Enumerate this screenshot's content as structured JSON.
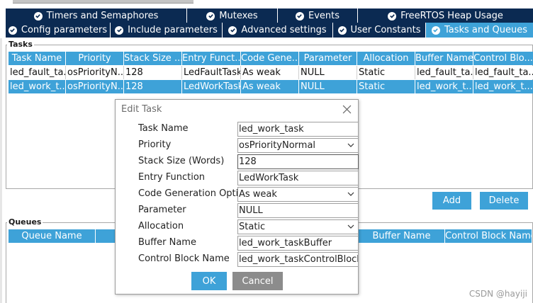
{
  "tabs_row1": [
    {
      "label": "Timers and Semaphores"
    },
    {
      "label": "Mutexes"
    },
    {
      "label": "Events"
    },
    {
      "label": "FreeRTOS Heap Usage"
    }
  ],
  "tabs_row2": [
    {
      "label": "Config parameters"
    },
    {
      "label": "Include parameters"
    },
    {
      "label": "Advanced settings"
    },
    {
      "label": "User Constants"
    },
    {
      "label": "Tasks and Queues",
      "active": true
    }
  ],
  "tasks": {
    "title": "Tasks",
    "columns": [
      "Task Name",
      "Priority",
      "Stack Size ...",
      "Entry Funct...",
      "Code Gene...",
      "Parameter",
      "Allocation",
      "Buffer Name",
      "Control Blo..."
    ],
    "rows": [
      [
        "led_fault_ta...",
        "osPriorityN...",
        "128",
        "LedFaultTask",
        "As weak",
        "NULL",
        "Static",
        "led_fault_ta...",
        "led_fault_ta..."
      ],
      [
        "led_work_t...",
        "osPriorityN...",
        "128",
        "LedWorkTask",
        "As weak",
        "NULL",
        "Static",
        "led_work_t...",
        "led_work_t..."
      ]
    ],
    "selected_row": 1,
    "add_label": "Add",
    "delete_label": "Delete"
  },
  "queues": {
    "title": "Queues",
    "columns": {
      "queue_name": "Queue Name",
      "buffer_name": "Buffer Name",
      "control_block_name": "Control Block Name"
    }
  },
  "dialog": {
    "title": "Edit Task",
    "fields": [
      {
        "label": "Task Name",
        "value": "led_work_task",
        "kind": "text"
      },
      {
        "label": "Priority",
        "value": "osPriorityNormal",
        "kind": "select"
      },
      {
        "label": "Stack Size (Words)",
        "value": "128",
        "kind": "text"
      },
      {
        "label": "Entry Function",
        "value": "LedWorkTask",
        "kind": "text"
      },
      {
        "label": "Code Generation Option",
        "value": "As weak",
        "kind": "select"
      },
      {
        "label": "Parameter",
        "value": "NULL",
        "kind": "text"
      },
      {
        "label": "Allocation",
        "value": "Static",
        "kind": "select"
      },
      {
        "label": "Buffer Name",
        "value": "led_work_taskBuffer",
        "kind": "text"
      },
      {
        "label": "Control Block Name",
        "value": "led_work_taskControlBlock",
        "kind": "text"
      }
    ],
    "ok_label": "OK",
    "cancel_label": "Cancel"
  },
  "watermark": "CSDN @hayiji",
  "colors": {
    "tab_dark": "#0b2a52",
    "accent": "#3ea2d8",
    "cancel": "#8c8c8c"
  }
}
